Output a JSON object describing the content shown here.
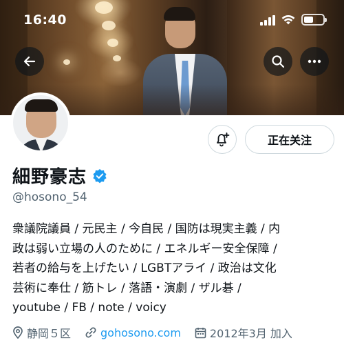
{
  "status_bar": {
    "time": "16:40",
    "battery_level": 0.5
  },
  "profile": {
    "display_name": "細野豪志",
    "verified": true,
    "handle": "@hosono_54",
    "follow_button_label": "正在关注",
    "bio_lines": [
      "衆議院議員 / 元民主 / 今自民 / 国防は現実主義 / 内",
      "政は弱い立場の人のために / エネルギー安全保障 /",
      "若者の給与を上げたい / LGBTアライ / 政治は文化",
      "芸術に奉仕 / 筋トレ / 落語・演劇 / ザル碁 /",
      "youtube / FB / note / voicy"
    ],
    "location": "静岡５区",
    "website": "gohosono.com",
    "joined": "2012年3月 加入"
  },
  "icons": {
    "back": "arrow-left-icon",
    "search": "search-icon",
    "more": "more-horizontal-icon",
    "notification": "bell-plus-icon",
    "verified": "verified-badge-icon",
    "location": "location-pin-icon",
    "link": "link-icon",
    "calendar": "calendar-icon"
  },
  "colors": {
    "accent": "#1d9bf0",
    "secondary_text": "#536471",
    "text": "#0f1419",
    "border": "#cfd9de"
  }
}
